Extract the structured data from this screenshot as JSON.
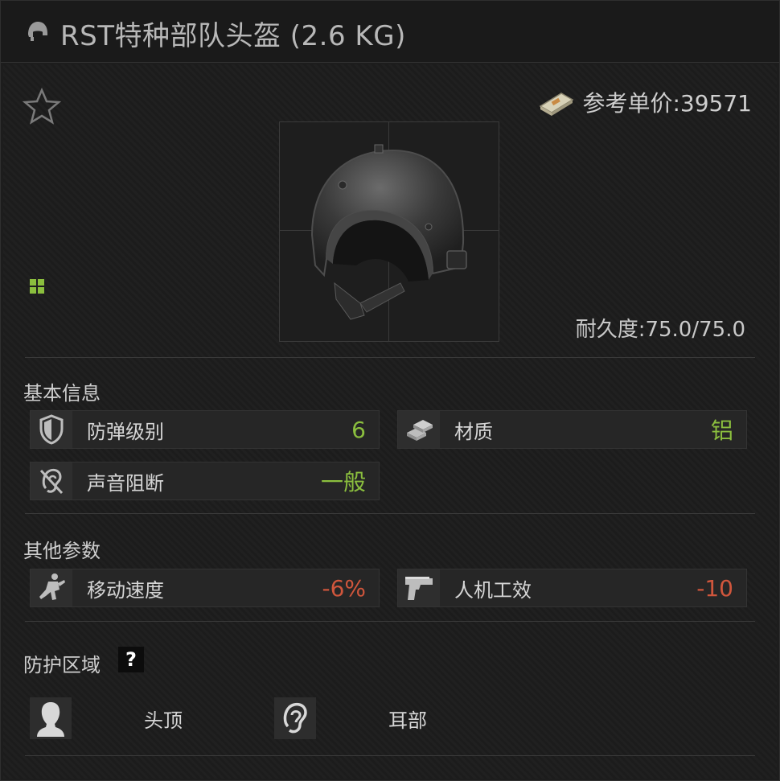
{
  "title": "RST特种部队头盔 (2.6 KG)",
  "price": {
    "label": "参考单价:39571"
  },
  "durability": {
    "label": "耐久度:",
    "value": "75.0/75.0"
  },
  "basic_info": {
    "title": "基本信息",
    "stats": [
      {
        "label": "防弹级别",
        "value": "6",
        "icon": "shield-icon",
        "tone": "good"
      },
      {
        "label": "材质",
        "value": "铝",
        "icon": "ingots-icon",
        "tone": "good"
      },
      {
        "label": "声音阻断",
        "value": "一般",
        "icon": "ear-blocked-icon",
        "tone": "good"
      }
    ]
  },
  "other_params": {
    "title": "其他参数",
    "stats": [
      {
        "label": "移动速度",
        "value": "-6%",
        "icon": "running-soldier-icon",
        "tone": "bad"
      },
      {
        "label": "人机工效",
        "value": "-10",
        "icon": "pistol-icon",
        "tone": "bad"
      }
    ]
  },
  "protection": {
    "title": "防护区域",
    "help": "?",
    "zones": [
      {
        "label": "头顶",
        "icon": "head-silhouette-icon"
      },
      {
        "label": "耳部",
        "icon": "ear-icon"
      }
    ]
  },
  "colors": {
    "good": "#8bbf3e",
    "bad": "#d0563c",
    "background": "#1d1d1d"
  }
}
